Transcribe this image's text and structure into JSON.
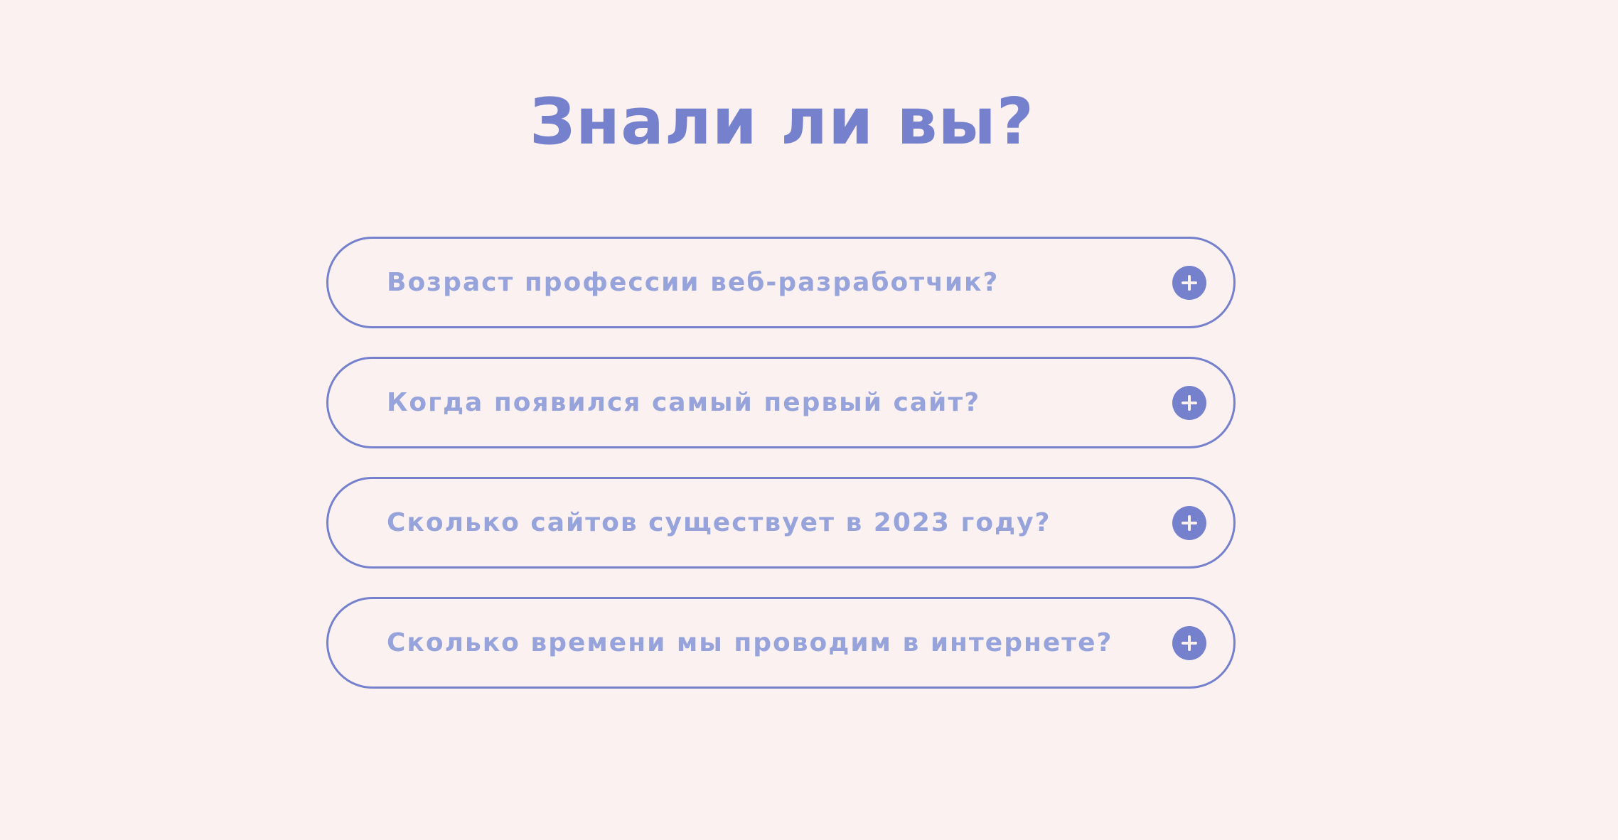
{
  "section": {
    "title": "Знали ли вы?"
  },
  "faq": {
    "items": [
      {
        "question": "Возраст профессии веб-разработчик?",
        "icon": "plus-icon"
      },
      {
        "question": "Когда появился самый первый сайт?",
        "icon": "plus-icon"
      },
      {
        "question": "Сколько сайтов существует в 2023 году?",
        "icon": "plus-icon"
      },
      {
        "question": "Сколько времени мы проводим в интернете?",
        "icon": "plus-icon"
      }
    ]
  },
  "colors": {
    "background": "#fbf1f1",
    "accent": "#7581cd",
    "question_text": "#97a3db"
  }
}
